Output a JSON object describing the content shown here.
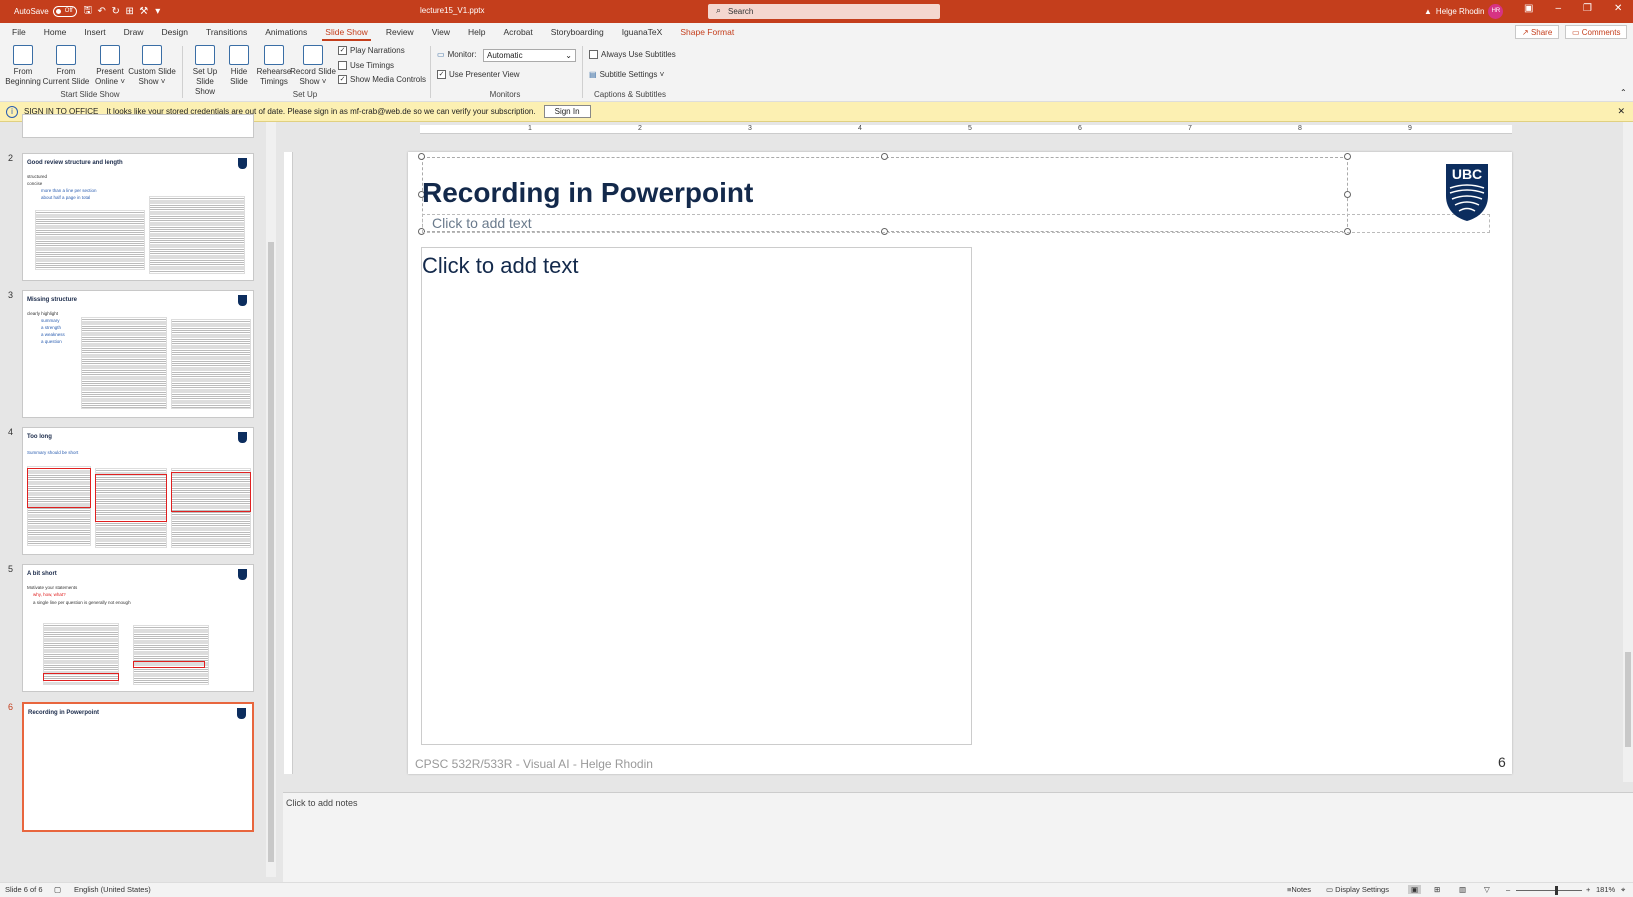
{
  "titlebar": {
    "autosave_label": "AutoSave",
    "autosave_state": "Off",
    "doc_title": "lecture15_V1.pptx",
    "search_placeholder": "Search",
    "user_name": "Helge Rhodin",
    "user_initials": "HR",
    "accent_color": "#c43e1c"
  },
  "menu": {
    "tabs": [
      "File",
      "Home",
      "Insert",
      "Draw",
      "Design",
      "Transitions",
      "Animations",
      "Slide Show",
      "Review",
      "View",
      "Help",
      "Acrobat",
      "Storyboarding",
      "IguanaTeX",
      "Shape Format"
    ],
    "active_tab": "Slide Show",
    "share_label": "Share",
    "comments_label": "Comments"
  },
  "ribbon": {
    "start_group": {
      "label": "Start Slide Show",
      "from_beginning": [
        "From",
        "Beginning"
      ],
      "from_current": [
        "From",
        "Current Slide"
      ],
      "present_online": [
        "Present",
        "Online ˅"
      ],
      "custom_show": [
        "Custom Slide",
        "Show ˅"
      ]
    },
    "setup_group": {
      "label": "Set Up",
      "setup_show": [
        "Set Up",
        "Slide Show"
      ],
      "hide_slide": [
        "Hide",
        "Slide"
      ],
      "rehearse": [
        "Rehearse",
        "Timings"
      ],
      "record": [
        "Record Slide",
        "Show ˅"
      ],
      "play_narrations": "Play Narrations",
      "use_timings": "Use Timings",
      "show_media_controls": "Show Media Controls"
    },
    "monitors_group": {
      "label": "Monitors",
      "monitor_label": "Monitor:",
      "monitor_value": "Automatic",
      "presenter_view": "Use Presenter View"
    },
    "captions_group": {
      "label": "Captions & Subtitles",
      "always_subtitles": "Always Use Subtitles",
      "subtitle_settings": "Subtitle Settings ˅"
    }
  },
  "infobar": {
    "title": "SIGN IN TO OFFICE",
    "message": "It looks like your stored credentials are out of date. Please sign in as mf-crab@web.de so we can verify your subscription.",
    "button": "Sign In"
  },
  "thumbnails": [
    {
      "num": "2",
      "title": "Good review structure and length",
      "bullets": [
        "structured",
        "concise",
        "more than a line per section",
        "about half a page in total"
      ]
    },
    {
      "num": "3",
      "title": "Missing structure",
      "bullets": [
        "clearly highlight",
        "summary",
        "a strength",
        "a weakness",
        "a question"
      ]
    },
    {
      "num": "4",
      "title": "Too long",
      "bullets": [
        "Summary should be short"
      ]
    },
    {
      "num": "5",
      "title": "A bit short",
      "bullets": [
        "Motivate your statements",
        "why, how, what?",
        "a single line per question is generally not enough"
      ]
    },
    {
      "num": "6",
      "title": "Recording in Powerpoint",
      "bullets": []
    }
  ],
  "slide": {
    "title": "Recording in Powerpoint",
    "subtitle_placeholder": "Click to add text",
    "content_placeholder": "Click to add text",
    "footer": "CPSC 532R/533R - Visual AI - Helge Rhodin",
    "page_number": "6",
    "logo_text": "UBC"
  },
  "ruler": [
    "1",
    "2",
    "3",
    "4",
    "5",
    "6",
    "7",
    "8",
    "9"
  ],
  "notes": {
    "placeholder": "Click to add notes"
  },
  "status": {
    "slide_info": "Slide 6 of 6",
    "language": "English (United States)",
    "notes": "Notes",
    "display_settings": "Display Settings",
    "zoom": "181%"
  }
}
